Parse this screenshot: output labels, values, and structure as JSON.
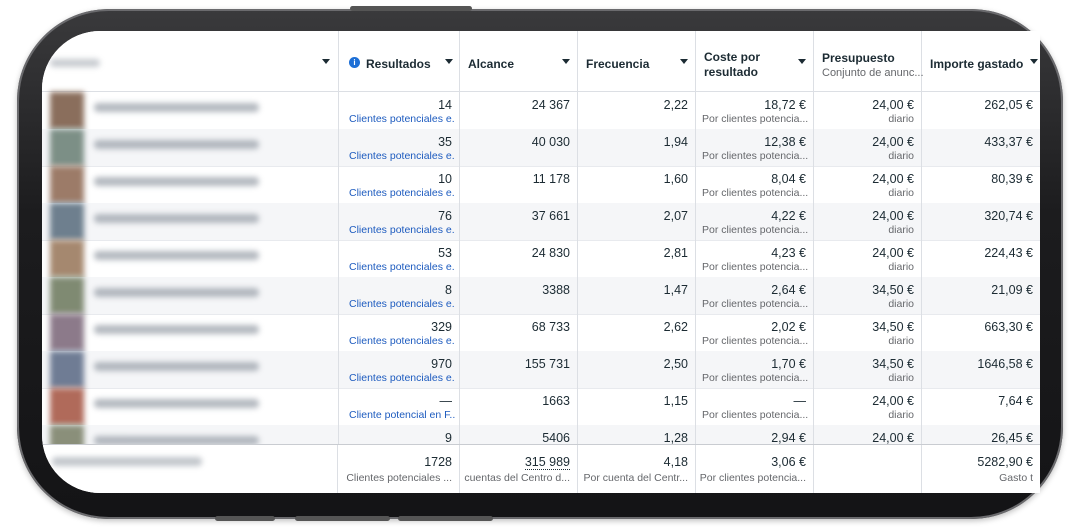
{
  "columns": {
    "results": {
      "label": "Resultados"
    },
    "reach": {
      "label": "Alcance"
    },
    "frequency": {
      "label": "Frecuencia"
    },
    "cost_line1": "Coste por",
    "cost_line2": "resultado",
    "budget": {
      "label": "Presupuesto",
      "sub": "Conjunto de anunc..."
    },
    "spent": {
      "label": "Importe gastado"
    }
  },
  "rows": [
    {
      "results": "14",
      "results_sub": "Clientes potenciales e...",
      "reach": "24 367",
      "frequency": "2,22",
      "cost": "18,72 €",
      "cost_sub": "Por clientes potencia...",
      "budget": "24,00 €",
      "budget_sub": "diario",
      "spent": "262,05 €"
    },
    {
      "results": "35",
      "results_sub": "Clientes potenciales e...",
      "reach": "40 030",
      "frequency": "1,94",
      "cost": "12,38 €",
      "cost_sub": "Por clientes potencia...",
      "budget": "24,00 €",
      "budget_sub": "diario",
      "spent": "433,37 €"
    },
    {
      "results": "10",
      "results_sub": "Clientes potenciales e...",
      "reach": "11 178",
      "frequency": "1,60",
      "cost": "8,04 €",
      "cost_sub": "Por clientes potencia...",
      "budget": "24,00 €",
      "budget_sub": "diario",
      "spent": "80,39 €"
    },
    {
      "results": "76",
      "results_sub": "Clientes potenciales e...",
      "reach": "37 661",
      "frequency": "2,07",
      "cost": "4,22 €",
      "cost_sub": "Por clientes potencia...",
      "budget": "24,00 €",
      "budget_sub": "diario",
      "spent": "320,74 €"
    },
    {
      "results": "53",
      "results_sub": "Clientes potenciales e...",
      "reach": "24 830",
      "frequency": "2,81",
      "cost": "4,23 €",
      "cost_sub": "Por clientes potencia...",
      "budget": "24,00 €",
      "budget_sub": "diario",
      "spent": "224,43 €"
    },
    {
      "results": "8",
      "results_sub": "Clientes potenciales e...",
      "reach": "3388",
      "frequency": "1,47",
      "cost": "2,64 €",
      "cost_sub": "Por clientes potencia...",
      "budget": "34,50 €",
      "budget_sub": "diario",
      "spent": "21,09 €"
    },
    {
      "results": "329",
      "results_sub": "Clientes potenciales e...",
      "reach": "68 733",
      "frequency": "2,62",
      "cost": "2,02 €",
      "cost_sub": "Por clientes potencia...",
      "budget": "34,50 €",
      "budget_sub": "diario",
      "spent": "663,30 €"
    },
    {
      "results": "970",
      "results_sub": "Clientes potenciales e...",
      "reach": "155 731",
      "frequency": "2,50",
      "cost": "1,70 €",
      "cost_sub": "Por clientes potencia...",
      "budget": "34,50 €",
      "budget_sub": "diario",
      "spent": "1646,58 €"
    },
    {
      "results": "—",
      "results_sub": "Cliente potencial en F...",
      "reach": "1663",
      "frequency": "1,15",
      "cost": "—",
      "cost_sub": "Por clientes potencia...",
      "budget": "24,00 €",
      "budget_sub": "diario",
      "spent": "7,64 €"
    },
    {
      "results": "9",
      "results_sub": "",
      "reach": "5406",
      "frequency": "1,28",
      "cost": "2,94 €",
      "cost_sub": "",
      "budget": "24,00 €",
      "budget_sub": "",
      "spent": "26,45 €"
    }
  ],
  "totals": {
    "results": "1728",
    "results_sub": "Clientes potenciales ...",
    "reach": "315 989",
    "reach_sub": "cuentas del Centro d...",
    "frequency": "4,18",
    "frequency_sub": "Por cuenta del Centr...",
    "cost": "3,06 €",
    "cost_sub": "Por clientes potencia...",
    "spent": "5282,90 €",
    "spent_sub": "Gasto t"
  },
  "colors": {
    "link": "#1d5bbf",
    "info_icon": "#1d6fd6",
    "alt_row": "#f5f6f8"
  }
}
